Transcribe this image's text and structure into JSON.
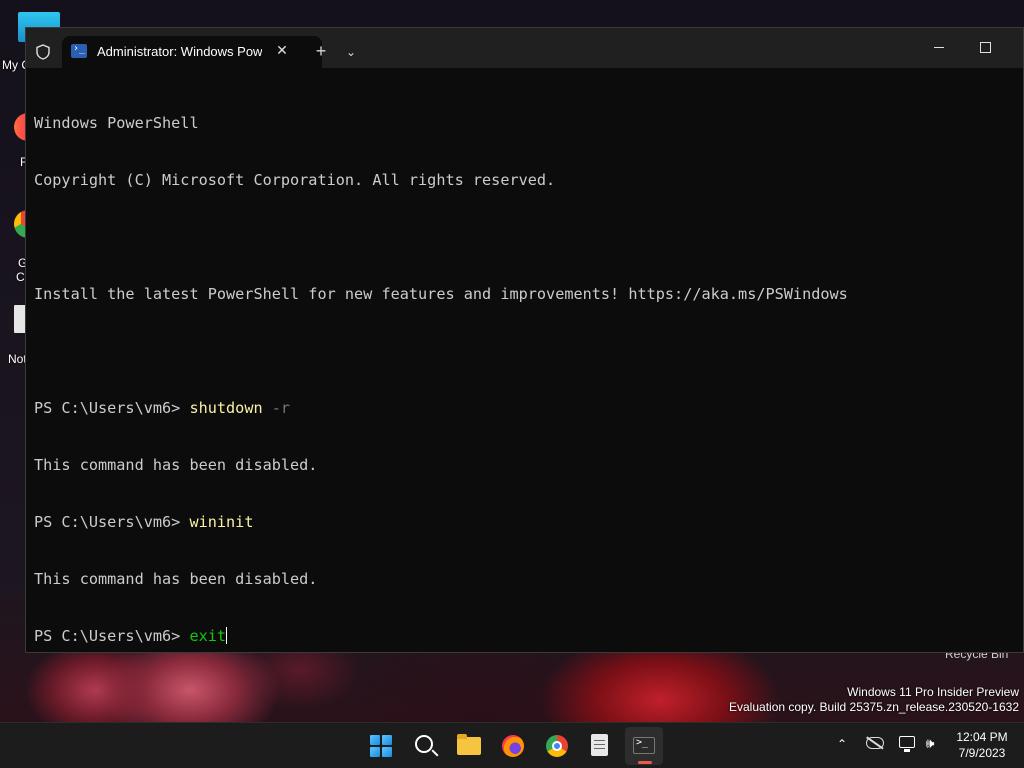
{
  "desktop": {
    "icons": [
      {
        "label": "My C"
      },
      {
        "label": "F"
      },
      {
        "label": "G"
      },
      {
        "label": "C"
      },
      {
        "label": "Not"
      }
    ],
    "recycle_bin_label": "Recycle Bin",
    "watermark": {
      "line1": "Windows 11 Pro Insider Preview",
      "line2": "Evaluation copy. Build 25375.zn_release.230520-1632"
    }
  },
  "window": {
    "tab_title": "Administrator: Windows PowerShell",
    "tab_close_glyph": "✕",
    "new_tab_glyph": "+",
    "dropdown_glyph": "⌄",
    "console": {
      "header_line1": "Windows PowerShell",
      "header_line2": "Copyright (C) Microsoft Corporation. All rights reserved.",
      "install_msg": "Install the latest PowerShell for new features and improvements! https://aka.ms/PSWindows",
      "prompt": "PS C:\\Users\\vm6> ",
      "cmd1": "shutdown",
      "cmd1_arg": " -r",
      "disabled_msg1": "This command has been disabled.",
      "cmd2": "wininit",
      "disabled_msg2": "This command has been disabled.",
      "current_input": "exit"
    },
    "colors": {
      "background": "#0c0c0c",
      "text": "#cccccc",
      "command": "#f9f1a5",
      "argument": "#767676",
      "typing": "#16c60c"
    }
  },
  "taskbar": {
    "apps": [
      {
        "name": "start",
        "icon": "windows-start-icon"
      },
      {
        "name": "search",
        "icon": "search-icon"
      },
      {
        "name": "file-explorer",
        "icon": "folder-icon"
      },
      {
        "name": "firefox",
        "icon": "firefox-icon"
      },
      {
        "name": "chrome",
        "icon": "chrome-icon"
      },
      {
        "name": "notepad",
        "icon": "notepad-icon"
      },
      {
        "name": "terminal",
        "icon": "terminal-icon",
        "active": true
      }
    ],
    "tray": {
      "chevron_glyph": "⌃",
      "volume_glyph": "🕪"
    },
    "clock": {
      "time": "12:04 PM",
      "date": "7/9/2023"
    }
  }
}
